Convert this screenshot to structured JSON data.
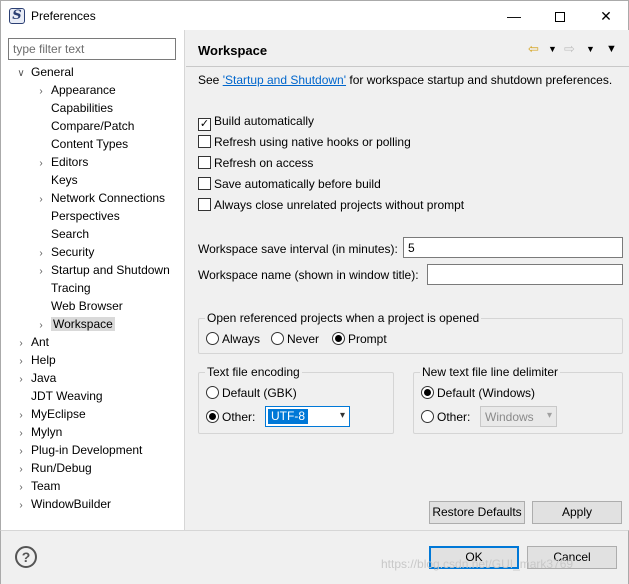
{
  "window": {
    "title": "Preferences",
    "icon_name": "eclipse-icon",
    "controls": {
      "minimize": "—",
      "close": "✕"
    }
  },
  "filter": {
    "placeholder": "type filter text"
  },
  "tree": [
    {
      "label": "General",
      "expanded": true,
      "level": 0
    },
    {
      "label": "Appearance",
      "level": 1,
      "has_children": true
    },
    {
      "label": "Capabilities",
      "level": 1
    },
    {
      "label": "Compare/Patch",
      "level": 1
    },
    {
      "label": "Content Types",
      "level": 1
    },
    {
      "label": "Editors",
      "level": 1,
      "has_children": true
    },
    {
      "label": "Keys",
      "level": 1
    },
    {
      "label": "Network Connections",
      "level": 1,
      "has_children": true
    },
    {
      "label": "Perspectives",
      "level": 1
    },
    {
      "label": "Search",
      "level": 1
    },
    {
      "label": "Security",
      "level": 1,
      "has_children": true
    },
    {
      "label": "Startup and Shutdown",
      "level": 1,
      "has_children": true
    },
    {
      "label": "Tracing",
      "level": 1
    },
    {
      "label": "Web Browser",
      "level": 1
    },
    {
      "label": "Workspace",
      "level": 1,
      "has_children": true,
      "selected": true
    },
    {
      "label": "Ant",
      "level": 0,
      "has_children": true
    },
    {
      "label": "Help",
      "level": 0,
      "has_children": true
    },
    {
      "label": "Java",
      "level": 0,
      "has_children": true
    },
    {
      "label": "JDT Weaving",
      "level": 0
    },
    {
      "label": "MyEclipse",
      "level": 0,
      "has_children": true
    },
    {
      "label": "Mylyn",
      "level": 0,
      "has_children": true
    },
    {
      "label": "Plug-in Development",
      "level": 0,
      "has_children": true
    },
    {
      "label": "Run/Debug",
      "level": 0,
      "has_children": true
    },
    {
      "label": "Team",
      "level": 0,
      "has_children": true
    },
    {
      "label": "WindowBuilder",
      "level": 0,
      "has_children": true
    }
  ],
  "page": {
    "title": "Workspace",
    "see_prefix": "See ",
    "see_link": "'Startup and Shutdown'",
    "see_suffix": " for workspace startup and shutdown preferences.",
    "checkboxes": [
      {
        "label": "Build automatically",
        "checked": true
      },
      {
        "label": "Refresh using native hooks or polling",
        "checked": false
      },
      {
        "label": "Refresh on access",
        "checked": false
      },
      {
        "label": "Save automatically before build",
        "checked": false
      },
      {
        "label": "Always close unrelated projects without prompt",
        "checked": false
      }
    ],
    "save_interval_label": "Workspace save interval (in minutes):",
    "save_interval_value": "5",
    "workspace_name_label": "Workspace name (shown in window title):",
    "workspace_name_value": "",
    "open_ref": {
      "title": "Open referenced projects when a project is opened",
      "options": [
        {
          "label": "Always",
          "selected": false
        },
        {
          "label": "Never",
          "selected": false
        },
        {
          "label": "Prompt",
          "selected": true
        }
      ]
    },
    "encoding": {
      "title": "Text file encoding",
      "default_label": "Default (GBK)",
      "default_selected": false,
      "other_label": "Other:",
      "other_selected": true,
      "other_value": "UTF-8"
    },
    "delimiter": {
      "title": "New text file line delimiter",
      "default_label": "Default (Windows)",
      "default_selected": true,
      "other_label": "Other:",
      "other_selected": false,
      "other_value": "Windows"
    },
    "restore_defaults_label": "Restore Defaults",
    "apply_label": "Apply"
  },
  "footer": {
    "ok_label": "OK",
    "cancel_label": "Cancel",
    "help_symbol": "?",
    "watermark": "https://blog.csdn.net/GUI_mark3769"
  }
}
